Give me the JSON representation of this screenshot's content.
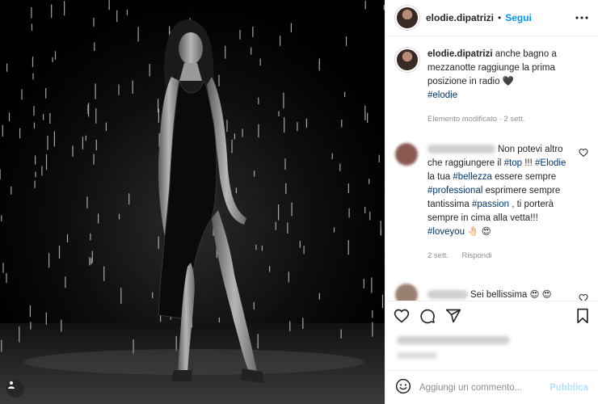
{
  "header": {
    "username": "elodie.dipatrizi",
    "separator": "•",
    "follow_label": "Segui",
    "more_icon": "more-horizontal-icon"
  },
  "caption": {
    "username": "elodie.dipatrizi",
    "text": "anche bagno a mezzanotte raggiunge la prima posizione in radio 🖤",
    "hashtag": "#elodie",
    "meta": "Elemento modificato · 2 sett."
  },
  "comments": [
    {
      "parts": [
        {
          "t": "Non potevi altro che raggiungere il ",
          "h": false
        },
        {
          "t": "#top",
          "h": true
        },
        {
          "t": " !!! ",
          "h": false
        },
        {
          "t": "#Elodie",
          "h": true
        },
        {
          "t": " la tua ",
          "h": false
        },
        {
          "t": "#bellezza",
          "h": true
        },
        {
          "t": " essere sempre ",
          "h": false
        },
        {
          "t": "#professional",
          "h": true
        },
        {
          "t": " esprimere sempre tantissima ",
          "h": false
        },
        {
          "t": "#passion",
          "h": true
        },
        {
          "t": " , ti porterà sempre in cima alla vetta!!! ",
          "h": false
        },
        {
          "t": "#loveyou",
          "h": true
        },
        {
          "t": " 🤚🏻 😍",
          "h": false
        }
      ],
      "time": "2 sett.",
      "reply_label": "Rispondi",
      "avatar_color": "#8a5a52"
    },
    {
      "parts": [
        {
          "t": "Sei bellissima 😍 😍",
          "h": false
        }
      ],
      "avatar_color": "#9a8070"
    }
  ],
  "actions": {
    "like_icon": "heart-icon",
    "comment_icon": "comment-icon",
    "share_icon": "share-icon",
    "save_icon": "bookmark-icon"
  },
  "add_comment": {
    "emoji_icon": "emoji-icon",
    "placeholder": "Aggiungi un commento...",
    "publish_label": "Pubblica"
  },
  "media": {
    "user_tag_icon": "user-tag-icon"
  }
}
